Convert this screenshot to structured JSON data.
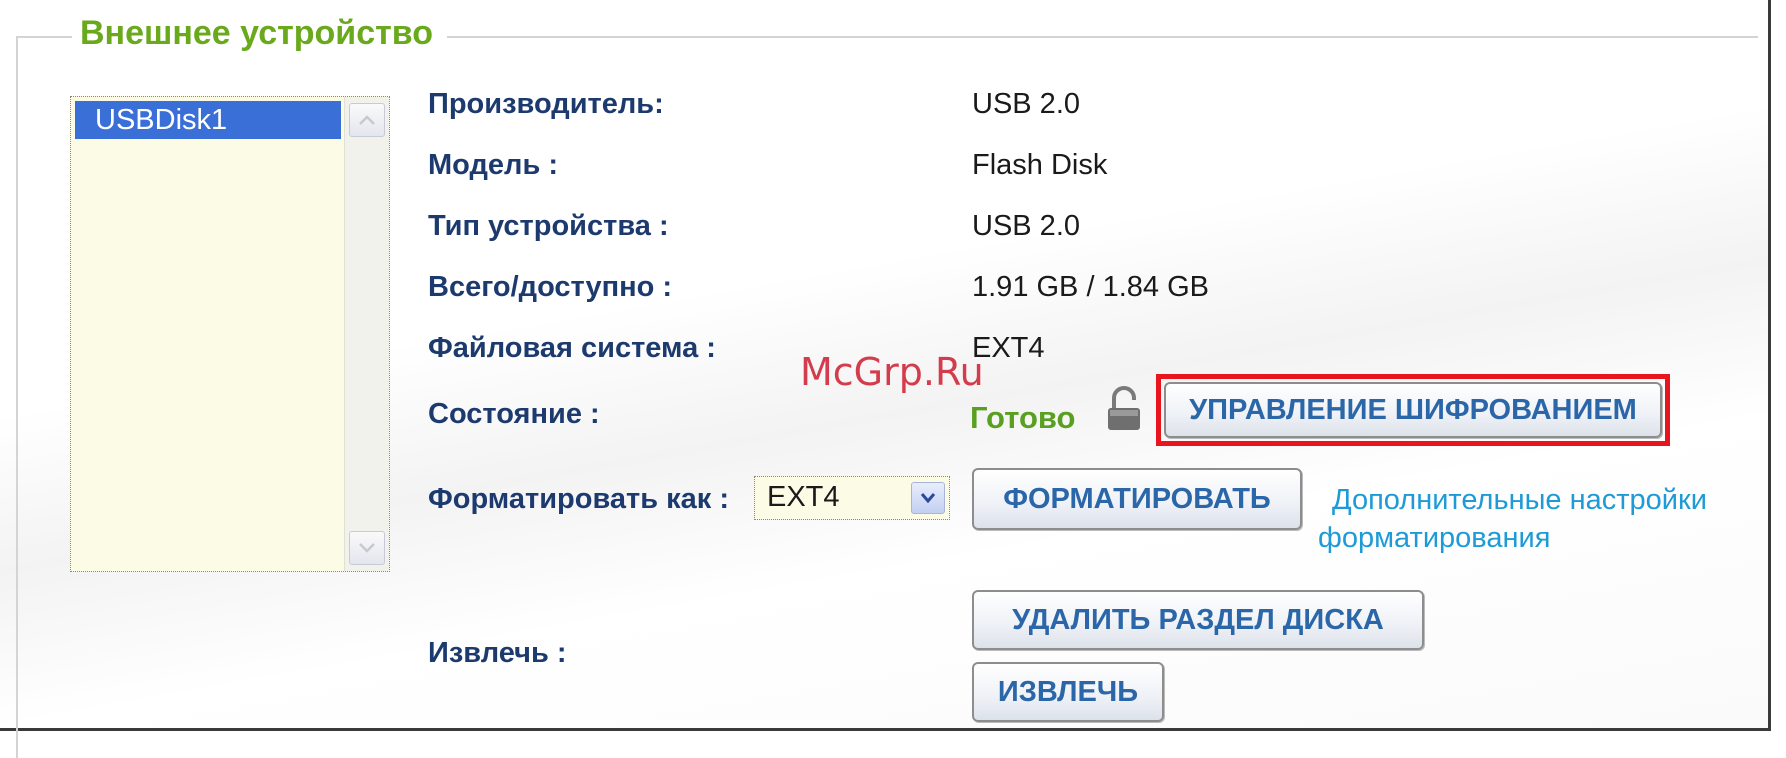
{
  "section": {
    "title": "Внешнее устройство"
  },
  "device_list": {
    "items": [
      "USBDisk1"
    ],
    "selected_index": 0
  },
  "fields": {
    "manufacturer": {
      "label": "Производитель:",
      "value": "USB 2.0"
    },
    "model": {
      "label": "Модель :",
      "value": "Flash Disk"
    },
    "device_type": {
      "label": "Тип устройства :",
      "value": "USB 2.0"
    },
    "total_available": {
      "label": "Всего/доступно :",
      "value": "1.91 GB / 1.84 GB"
    },
    "file_system": {
      "label": "Файловая система :",
      "value": "EXT4"
    },
    "status": {
      "label": "Состояние :",
      "value": "Готово"
    },
    "format_as": {
      "label": "Форматировать как :",
      "selected": "EXT4"
    },
    "eject": {
      "label": "Извлечь :"
    }
  },
  "buttons": {
    "encryption": "УПРАВЛЕНИЕ ШИФРОВАНИЕМ",
    "format": "ФОРМАТИРОВАТЬ",
    "delete_partition": "УДАЛИТЬ РАЗДЕЛ ДИСКА",
    "eject": "ИЗВЛЕЧЬ"
  },
  "links": {
    "advanced_format_line1": "Дополнительные настройки",
    "advanced_format_line2": "форматирования"
  },
  "watermark": "McGrp.Ru",
  "colors": {
    "legend": "#6aa81c",
    "label": "#1d3a6e",
    "status_ready": "#5aa020",
    "button_text": "#2a66a8",
    "link": "#1e9bd6",
    "highlight": "#e8151f",
    "selection": "#3a6fd8"
  },
  "icons": {
    "status": "lock-icon",
    "scroll_up": "arrow-up-icon",
    "scroll_down": "arrow-down-icon",
    "select": "chevron-down-icon"
  }
}
